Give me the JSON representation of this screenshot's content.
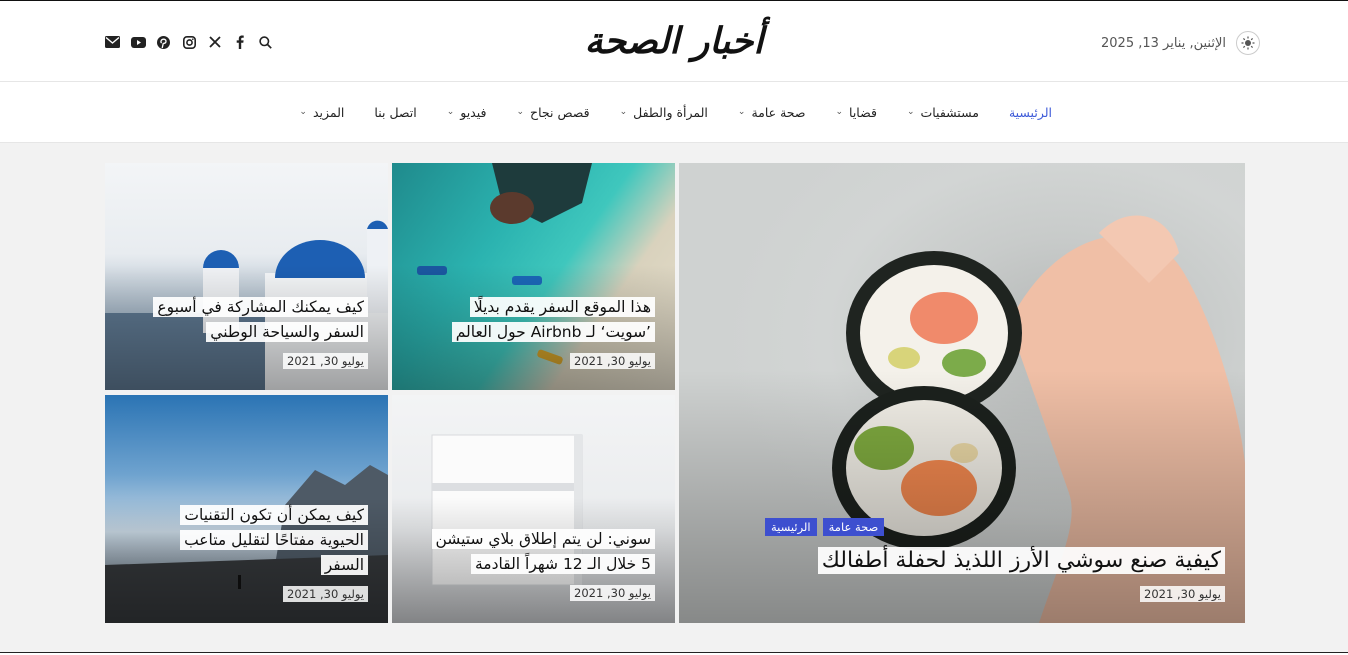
{
  "site": {
    "logo": "أخبار الصحة",
    "date": "الإثنين, يناير 13, 2025"
  },
  "social_icons": [
    "search-icon",
    "facebook-icon",
    "x-icon",
    "instagram-icon",
    "pinterest-icon",
    "youtube-icon",
    "email-icon"
  ],
  "nav": [
    {
      "label": "الرئيسية",
      "active": true,
      "dropdown": false
    },
    {
      "label": "مستشفيات",
      "dropdown": true
    },
    {
      "label": "قضايا",
      "dropdown": true
    },
    {
      "label": "صحة عامة",
      "dropdown": true
    },
    {
      "label": "المرأة والطفل",
      "dropdown": true
    },
    {
      "label": "قصص نجاح",
      "dropdown": true
    },
    {
      "label": "فيديو",
      "dropdown": true
    },
    {
      "label": "اتصل بنا",
      "dropdown": false
    },
    {
      "label": "المزيد",
      "dropdown": true
    }
  ],
  "featured": {
    "tags": [
      "الرئيسية",
      "صحة عامة"
    ],
    "title": "كيفية صنع سوشي الأرز اللذيذ لحفلة أطفالك",
    "date": "يوليو 30, 2021"
  },
  "cards": [
    {
      "title_lines": [
        "هذا الموقع السفر يقدم بديلًا",
        "’سويت‘ لـ Airbnb حول العالم"
      ],
      "date": "يوليو 30, 2021"
    },
    {
      "title_lines": [
        "كيف يمكنك المشاركة في أسبوع",
        "السفر والسياحة الوطني"
      ],
      "date": "يوليو 30, 2021"
    },
    {
      "title_lines": [
        "سوني: لن يتم إطلاق بلاي ستيشن",
        "5 خلال الـ 12 شهراً القادمة"
      ],
      "date": "يوليو 30, 2021"
    },
    {
      "title_lines": [
        "كيف يمكن أن تكون التقنيات",
        "الحيوية مفتاحًا لتقليل متاعب",
        "السفر"
      ],
      "date": "يوليو 30, 2021"
    }
  ],
  "colors": {
    "accent": "#3d4fcf",
    "nav_active": "#3d5ad8"
  }
}
